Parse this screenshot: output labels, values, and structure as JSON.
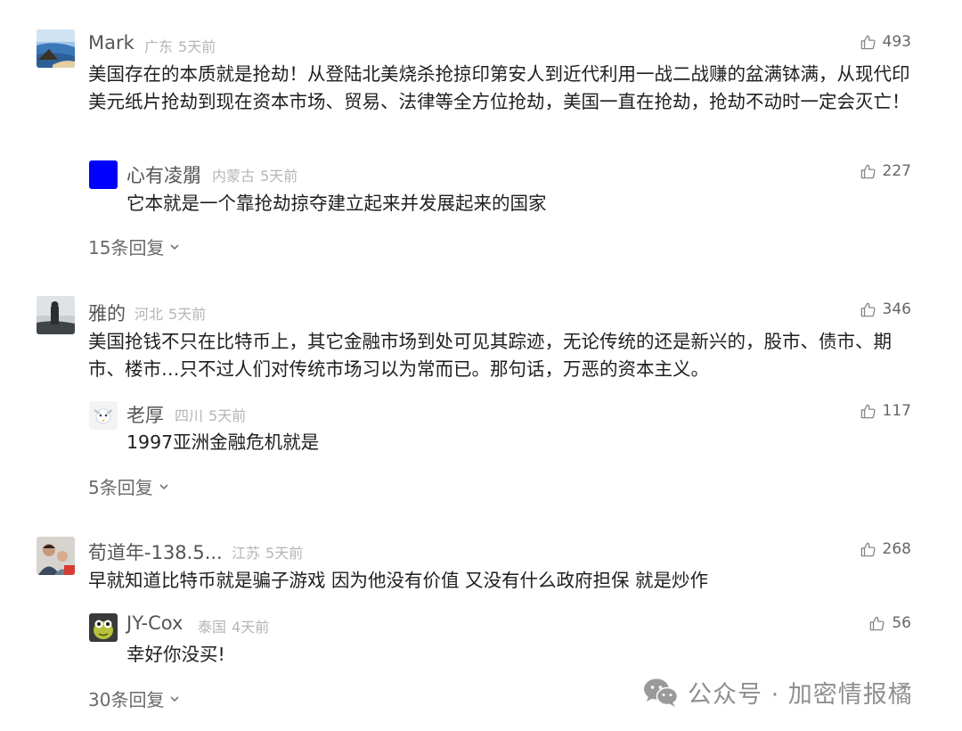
{
  "threads": [
    {
      "comment": {
        "user": "Mark",
        "location": "广东",
        "time": "5天前",
        "likes": "493",
        "text": "美国存在的本质就是抢劫！从登陆北美烧杀抢掠印第安人到近代利用一战二战赚的盆满钵满，从现代印美元纸片抢劫到现在资本市场、贸易、法律等全方位抢劫，美国一直在抢劫，抢劫不动时一定会灭亡！"
      },
      "reply": {
        "user": "心有凌朤",
        "location": "内蒙古",
        "time": "5天前",
        "likes": "227",
        "text": "它本就是一个靠抢劫掠夺建立起来并发展起来的国家"
      },
      "more_label": "15条回复"
    },
    {
      "comment": {
        "user": "雅的",
        "location": "河北",
        "time": "5天前",
        "likes": "346",
        "text": "美国抢钱不只在比特币上，其它金融市场到处可见其踪迹，无论传统的还是新兴的，股市、债市、期市、楼市…只不过人们对传统市场习以为常而已。那句话，万恶的资本主义。"
      },
      "reply": {
        "user": "老厚",
        "location": "四川",
        "time": "5天前",
        "likes": "117",
        "text": "1997亚洲金融危机就是"
      },
      "more_label": "5条回复"
    },
    {
      "comment": {
        "user": "荀道年-138.5...",
        "location": "江苏",
        "time": "5天前",
        "likes": "268",
        "text": "早就知道比特币就是骗子游戏 因为他没有价值 又没有什么政府担保 就是炒作"
      },
      "reply": {
        "user": "JY-Cox",
        "location": "泰国",
        "time": "4天前",
        "likes": "56",
        "text": "幸好你没买!"
      },
      "more_label": "30条回复"
    }
  ],
  "watermark": {
    "text": "公众号 · 加密情报橘",
    "icon": "wechat-icon"
  },
  "icons": {
    "like": "thumbs-up-icon",
    "expand": "chevron-down-icon"
  },
  "colors": {
    "meta": "#b5b5b5",
    "text": "#1f1f1f",
    "reply_avatar_blue": "#0000ff"
  }
}
